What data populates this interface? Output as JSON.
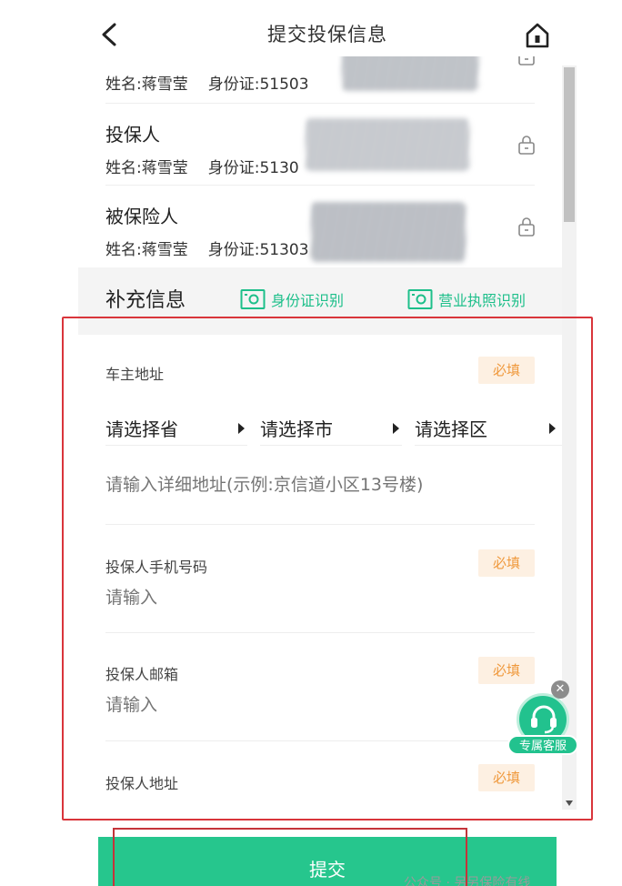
{
  "header": {
    "title": "提交投保信息"
  },
  "persons": [
    {
      "role": "",
      "name": "姓名:蒋雪莹",
      "id_label": "身份证:",
      "id_value": "51503"
    },
    {
      "role": "投保人",
      "name": "姓名:蒋雪莹",
      "id_label": "身份证:",
      "id_value": "5130"
    },
    {
      "role": "被保险人",
      "name": "姓名:蒋雪莹",
      "id_label": "身份证:",
      "id_value": "51303"
    }
  ],
  "supplement": {
    "title": "补充信息",
    "id_scan_label": "身份证识别",
    "license_scan_label": "营业执照识别"
  },
  "form": {
    "owner_address_label": "车主地址",
    "required_label": "必填",
    "province_placeholder": "请选择省",
    "city_placeholder": "请选择市",
    "district_placeholder": "请选择区",
    "detail_address_placeholder": "请输入详细地址(示例:京信道小区13号楼)",
    "phone_label": "投保人手机号码",
    "phone_placeholder": "请输入",
    "email_label": "投保人邮箱",
    "email_placeholder": "请输入",
    "holder_address_label": "投保人地址"
  },
  "customer_service": {
    "close_label": "✕",
    "label": "专属客服"
  },
  "submit_label": "提交",
  "watermark": "公众号 · 另另保险有线",
  "colors": {
    "brand_green": "#26c68d",
    "required_bg": "#fdf0e2",
    "required_text": "#f09a3e",
    "highlight_red": "#d9353b"
  }
}
